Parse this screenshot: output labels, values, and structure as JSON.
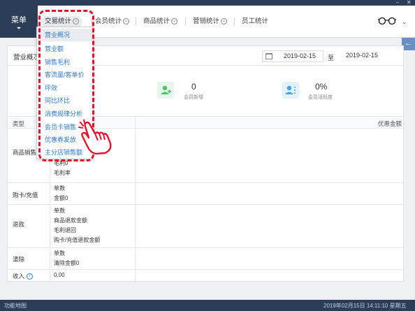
{
  "header": {
    "menu_label": "菜单",
    "menu_arrow": "⏷",
    "tabs": [
      {
        "label": "交易统计",
        "chev": "⌄"
      },
      {
        "label": "会员统计",
        "chev": "⌄"
      },
      {
        "label": "商品统计",
        "chev": "⌄"
      },
      {
        "label": "营销统计",
        "chev": "⌄"
      },
      {
        "label": "员工统计"
      }
    ],
    "user_chev": "⌄"
  },
  "window_controls": {
    "minimize": "–",
    "close": "✕"
  },
  "side_tab_icon": "←",
  "dropdown": {
    "items": [
      "营业概况",
      "营业额",
      "销售毛利",
      "客流量/客单价",
      "坪效",
      "同比环比",
      "消费规律分析",
      "会员卡销售",
      "优惠券发放",
      "主分店销售额"
    ],
    "hover_index": 0
  },
  "panel": {
    "title": "营业概况",
    "date_from": "2019-02-15",
    "date_sep": "至",
    "date_to": "2019-02-15",
    "stats": [
      {
        "icon": "user-plus-icon",
        "value": "0",
        "label": "会员新增",
        "color": "#4cc36a"
      },
      {
        "icon": "user-active-icon",
        "value": "0%",
        "label": "会员活跃度",
        "color": "#3da7e0"
      }
    ]
  },
  "table": {
    "headers": {
      "type": "类型",
      "right": "优惠金额"
    },
    "rows": [
      {
        "cat": "商品销售",
        "items": [
          "毛利0",
          "毛利率"
        ]
      },
      {
        "cat": "购卡/充值",
        "items": [
          "单数",
          "金额0"
        ]
      },
      {
        "cat": "退款",
        "items": [
          "单数",
          "商品退款金额",
          "毛利退回",
          "购卡/充值退款金额"
        ]
      },
      {
        "cat": "清除",
        "items": [
          "单数",
          "清除金额0"
        ]
      },
      {
        "cat": "收入",
        "items": [
          "0.00"
        ],
        "info": "i"
      }
    ]
  },
  "status": {
    "left": "功能地图",
    "right": "2019年02月15日 14:11:10 星期五"
  }
}
